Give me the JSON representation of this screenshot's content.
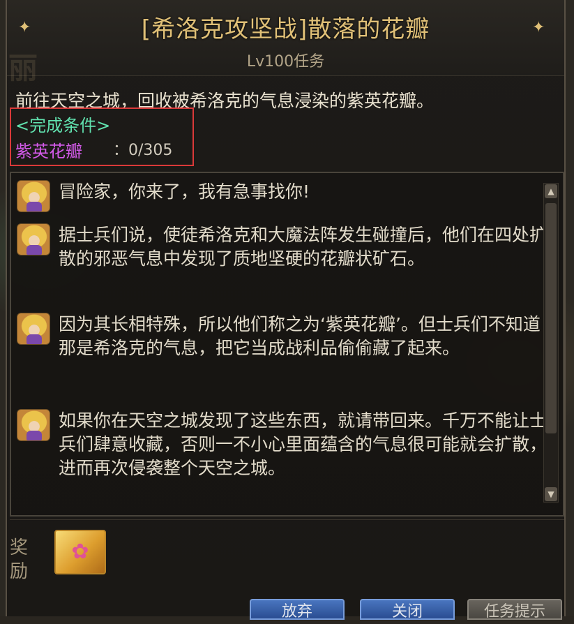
{
  "quest": {
    "title": "[希洛克攻坚战]散落的花瓣",
    "level": "Lv100任务",
    "description": "前往天空之城，回收被希洛克的气息浸染的紫英花瓣。",
    "condition_label": "<完成条件>",
    "condition_item": "紫英花瓣",
    "condition_count": "：0/305"
  },
  "dialog": [
    {
      "text": "冒险家，你来了，我有急事找你!"
    },
    {
      "text": "据士兵们说，使徒希洛克和大魔法阵发生碰撞后，他们在四处扩散的邪恶气息中发现了质地坚硬的花瓣状矿石。"
    },
    {
      "text": "因为其长相特殊，所以他们称之为‘紫英花瓣’。但士兵们不知道那是希洛克的气息，把它当成战利品偷偷藏了起来。"
    },
    {
      "text": "如果你在天空之城发现了这些东西，就请带回来。千万不能让士兵们肆意收藏，否则一不小心里面蕴含的气息很可能就会扩散，进而再次侵袭整个天空之城。"
    }
  ],
  "reward": {
    "label": "奖励"
  },
  "buttons": {
    "accept": "放弃",
    "back": "关闭",
    "hint": "任务提示"
  },
  "colors": {
    "title": "#e6c57a",
    "condition_label": "#63e8b4",
    "condition_item": "#d95cf0",
    "highlight_box": "#e03a3a"
  }
}
